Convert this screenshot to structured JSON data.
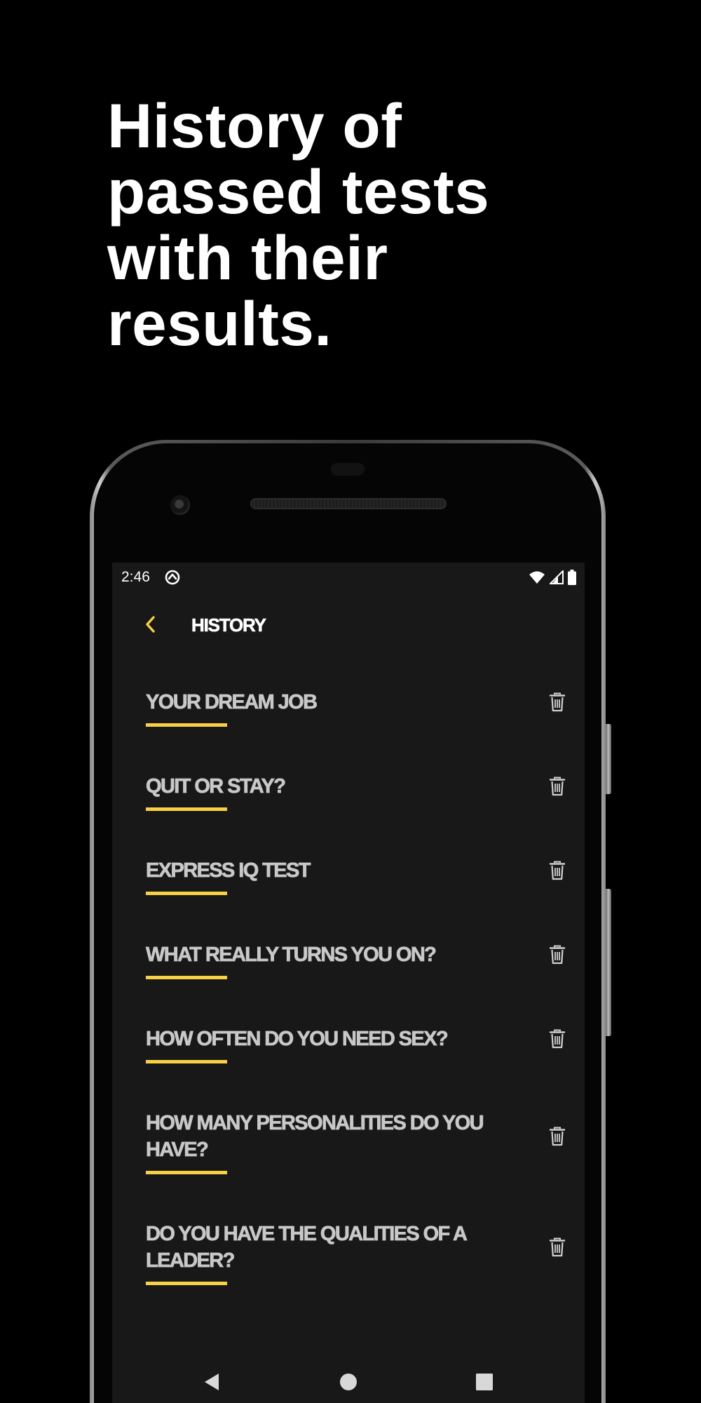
{
  "headline": {
    "lines": [
      "History of",
      "passed tests",
      "with their",
      "results."
    ]
  },
  "status_bar": {
    "time": "2:46",
    "icons": [
      "app-notification-icon",
      "wifi-icon",
      "cellular-signal-icon",
      "battery-icon"
    ]
  },
  "toolbar": {
    "title": "HISTORY",
    "back_icon": "chevron-left-icon"
  },
  "history": {
    "items": [
      {
        "title": "YOUR DREAM JOB"
      },
      {
        "title": "QUIT OR STAY?"
      },
      {
        "title": "EXPRESS IQ TEST"
      },
      {
        "title": "WHAT REALLY TURNS YOU ON?"
      },
      {
        "title": "HOW OFTEN DO YOU NEED SEX?"
      },
      {
        "title": "HOW MANY PERSONALITIES DO YOU HAVE?"
      },
      {
        "title": "DO YOU HAVE THE QUALITIES OF A LEADER?"
      }
    ],
    "delete_icon": "trash-icon"
  },
  "nav_bar": {
    "icons": [
      "back-triangle-icon",
      "home-circle-icon",
      "recents-square-icon"
    ]
  },
  "colors": {
    "background": "#000000",
    "screen": "#181818",
    "accent": "#f7d046",
    "item_text": "#c8c8c8",
    "title_text": "#ffffff"
  }
}
